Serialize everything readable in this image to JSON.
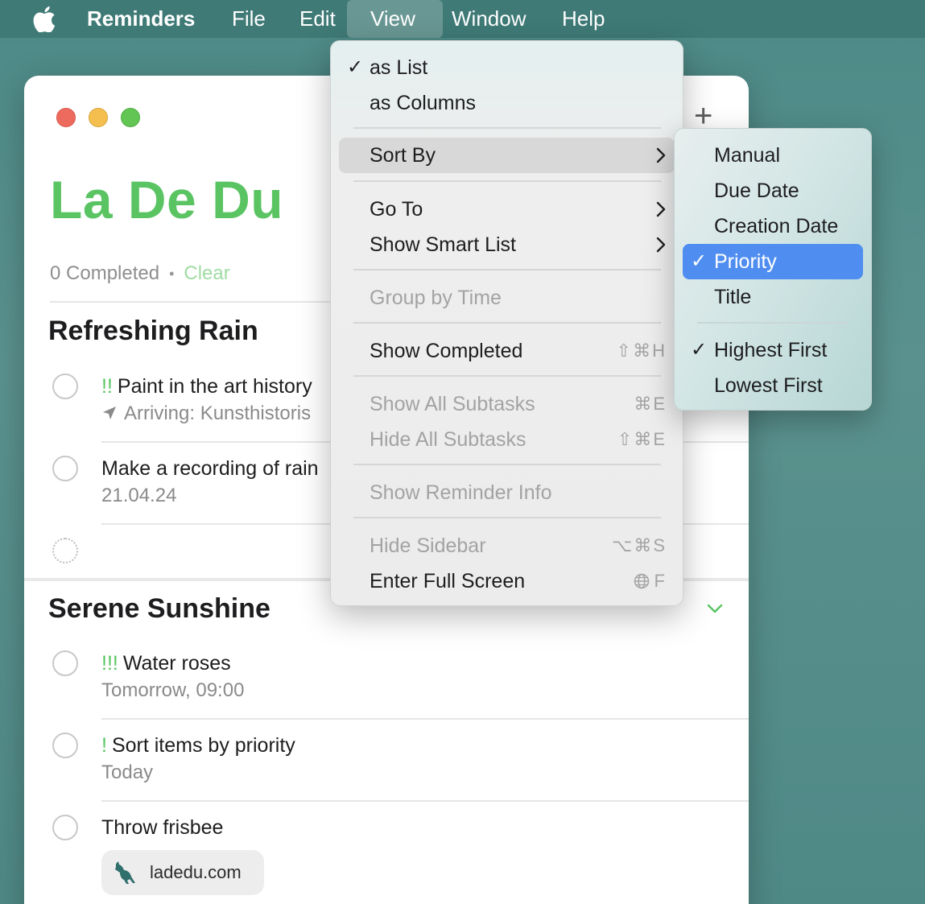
{
  "menubar": {
    "app_name": "Reminders",
    "items": [
      "File",
      "Edit",
      "View",
      "Window",
      "Help"
    ]
  },
  "window": {
    "list_title": "La De Du",
    "completed_label": "0 Completed",
    "clear_label": "Clear",
    "sections": [
      {
        "title": "Refreshing Rain",
        "tasks": [
          {
            "priority": "!!",
            "title": "Paint in the art history",
            "subtitle": "Arriving: Kunsthistoris"
          },
          {
            "priority": "",
            "title": "Make a recording of rain",
            "subtitle": "21.04.24"
          }
        ]
      },
      {
        "title": "Serene Sunshine",
        "tasks": [
          {
            "priority": "!!!",
            "title": "Water roses",
            "subtitle": "Tomorrow, 09:00"
          },
          {
            "priority": "!",
            "title": "Sort items by priority",
            "subtitle": "Today"
          },
          {
            "priority": "",
            "title": "Throw frisbee",
            "link": "ladedu.com"
          }
        ]
      }
    ]
  },
  "view_menu": {
    "as_list": "as List",
    "as_columns": "as Columns",
    "sort_by": "Sort By",
    "go_to": "Go To",
    "show_smart_list": "Show Smart List",
    "group_by_time": "Group by Time",
    "show_completed": "Show Completed",
    "show_completed_shortcut": "⇧⌘H",
    "show_all_subtasks": "Show All Subtasks",
    "show_all_subtasks_shortcut": "⌘E",
    "hide_all_subtasks": "Hide All Subtasks",
    "hide_all_subtasks_shortcut": "⇧⌘E",
    "show_reminder_info": "Show Reminder Info",
    "hide_sidebar": "Hide Sidebar",
    "hide_sidebar_shortcut": "⌥⌘S",
    "enter_full_screen": "Enter Full Screen",
    "enter_full_screen_shortcut": "F"
  },
  "sort_submenu": {
    "manual": "Manual",
    "due_date": "Due Date",
    "creation_date": "Creation Date",
    "priority": "Priority",
    "title": "Title",
    "highest_first": "Highest First",
    "lowest_first": "Lowest First"
  },
  "check_glyph": "✓",
  "colors": {
    "accent_green": "#5ac463",
    "selection_blue": "#4f8ef0",
    "desktop_teal": "#4d8a87"
  }
}
